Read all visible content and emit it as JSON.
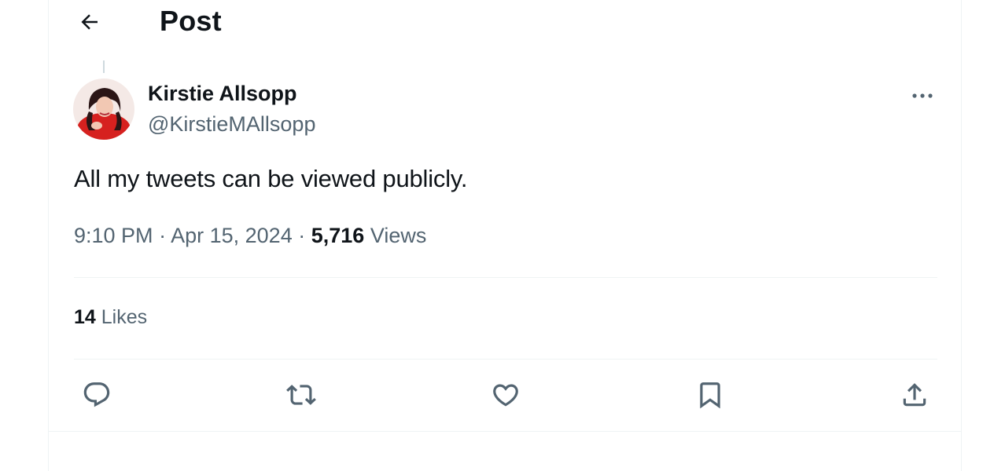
{
  "header": {
    "back_icon": "arrow-left-icon",
    "title": "Post"
  },
  "tweet": {
    "author": {
      "display_name": "Kirstie Allsopp",
      "handle": "@KirstieMAllsopp",
      "avatar": "profile-photo"
    },
    "more_icon": "ellipsis-icon",
    "text": "All my tweets can be viewed publicly.",
    "time": "9:10 PM",
    "date": "Apr 15, 2024",
    "separator": "·",
    "views_count": "5,716",
    "views_label": "Views",
    "likes_count": "14",
    "likes_label": "Likes"
  },
  "actions": [
    {
      "name": "reply",
      "icon": "reply-bubble-icon"
    },
    {
      "name": "repost",
      "icon": "repost-icon"
    },
    {
      "name": "like",
      "icon": "heart-icon"
    },
    {
      "name": "bookmark",
      "icon": "bookmark-icon"
    },
    {
      "name": "share",
      "icon": "share-upload-icon"
    }
  ],
  "colors": {
    "text_primary": "#0f1419",
    "text_secondary": "#536471",
    "border": "#eff3f4",
    "avatar_accent": "#d6211f"
  }
}
